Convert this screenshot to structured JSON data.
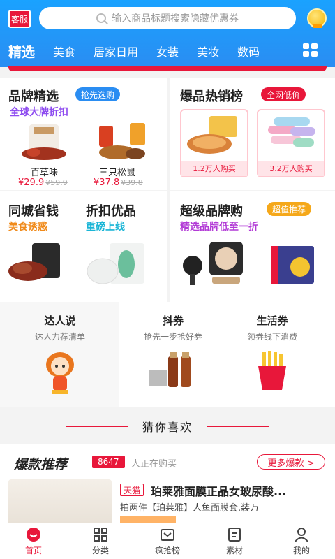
{
  "header": {
    "kefu_label": "客服",
    "search_placeholder": "输入商品标题搜索隐藏优惠券",
    "tabs": [
      "精选",
      "美食",
      "居家日用",
      "女装",
      "美妆",
      "数码"
    ],
    "active_tab": 0
  },
  "brand": {
    "title": "品牌精选",
    "pill": "抢先选购",
    "subtitle": "全球大牌折扣",
    "products": [
      {
        "name": "百草味",
        "price": "¥29.9",
        "orig": "¥59.9"
      },
      {
        "name": "三只松鼠",
        "price": "¥37.8",
        "orig": "¥39.8"
      }
    ]
  },
  "hot_list": {
    "title": "爆品热销榜",
    "pill": "全网低价",
    "items": [
      {
        "label": "1.2万人购买"
      },
      {
        "label": "3.2万人购买"
      }
    ]
  },
  "city": {
    "title": "同城省钱",
    "subtitle": "美食诱惑"
  },
  "discount": {
    "title": "折扣优品",
    "subtitle": "重磅上线"
  },
  "super_brand": {
    "title": "超级品牌购",
    "pill": "超值推荐",
    "subtitle": "精选品牌低至一折"
  },
  "mini": [
    {
      "title": "达人说",
      "sub": "达人力荐清单"
    },
    {
      "title": "抖券",
      "sub": "抢先一步抢好券"
    },
    {
      "title": "生活券",
      "sub": "领券线下消费"
    }
  ],
  "guess": {
    "label": "猜你喜欢"
  },
  "hot": {
    "title": "爆款推荐",
    "count": "8647",
    "now": "人正在购买",
    "more": "更多爆款 >",
    "item": {
      "tag": "天猫",
      "title": "珀莱雅面膜正品女玻尿酸...",
      "desc": "拍两件【珀莱雅】人鱼面膜套.装万"
    }
  },
  "nav": [
    {
      "label": "首页",
      "icon": "home-icon"
    },
    {
      "label": "分类",
      "icon": "category-icon"
    },
    {
      "label": "疯抢榜",
      "icon": "ranking-icon"
    },
    {
      "label": "素材",
      "icon": "material-icon"
    },
    {
      "label": "我的",
      "icon": "user-icon"
    }
  ],
  "colors": {
    "accent": "#e8173a",
    "header": "#1aa2ff"
  }
}
